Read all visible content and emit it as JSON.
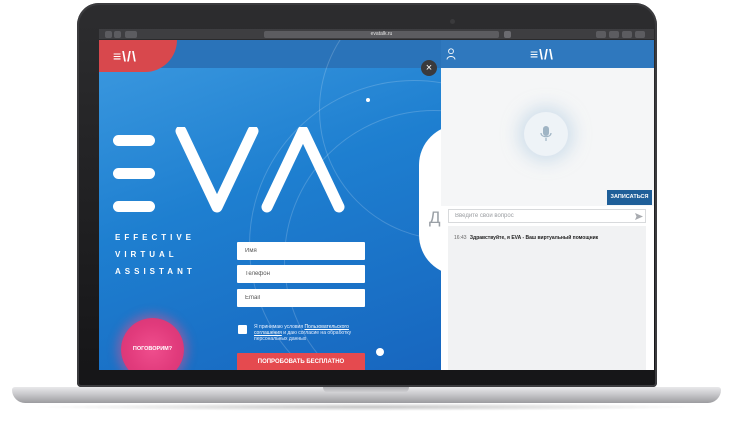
{
  "browser": {
    "url": "evatalk.ru"
  },
  "site": {
    "small_logo": "≡\\/\\",
    "tagline_lines": [
      "EFFECTIVE",
      "VIRTUAL",
      "ASSISTANT"
    ],
    "form": {
      "name_placeholder": "Имя",
      "phone_placeholder": "Телефон",
      "email_placeholder": "Email",
      "consent_prefix": "Я принимаю условия ",
      "consent_link": "Пользовательского соглашения",
      "consent_suffix": " и даю согласие на обработку персональных данных",
      "submit_label": "ПОПРОБОВАТЬ БЕСПЛАТНО"
    },
    "talk_button_label": "ПОГОВОРИМ?",
    "blob_letter": "Д"
  },
  "chat": {
    "close_symbol": "×",
    "header_logo": "≡\\/\\",
    "signup_label": "ЗАПИСАТЬСЯ",
    "input_placeholder": "Введите свой вопрос",
    "messages": [
      {
        "time": "16:43",
        "text": "Здравствуйте, я EVA - Ваш виртуальный помощник"
      }
    ]
  },
  "colors": {
    "brand_blue": "#2f78be",
    "accent_red": "#e54a4f",
    "talk_pink": "#e13b7c"
  }
}
